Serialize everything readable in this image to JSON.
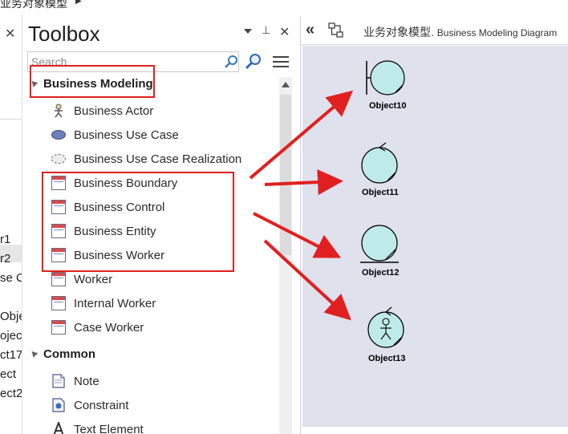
{
  "breadcrumb": {
    "text": "业务对象模型"
  },
  "left_panel": {
    "fragments": [
      "r1",
      "r2",
      "se C",
      "Obje",
      "oject",
      "ct17",
      "ect",
      "ect2"
    ]
  },
  "toolbox": {
    "title": "Toolbox",
    "search_placeholder": "Search",
    "groups": [
      {
        "label": "Business Modeling",
        "items": [
          {
            "label": "Business Actor",
            "icon": "actor-icon"
          },
          {
            "label": "Business Use Case",
            "icon": "use-case-icon"
          },
          {
            "label": "Business Use Case Realization",
            "icon": "use-case-realization-icon"
          },
          {
            "label": "Business Boundary",
            "icon": "class-icon"
          },
          {
            "label": "Business Control",
            "icon": "class-icon"
          },
          {
            "label": "Business Entity",
            "icon": "class-icon"
          },
          {
            "label": "Business Worker",
            "icon": "class-icon"
          },
          {
            "label": "Worker",
            "icon": "class-icon"
          },
          {
            "label": "Internal Worker",
            "icon": "class-icon"
          },
          {
            "label": "Case Worker",
            "icon": "class-icon"
          }
        ]
      },
      {
        "label": "Common",
        "items": [
          {
            "label": "Note",
            "icon": "note-icon"
          },
          {
            "label": "Constraint",
            "icon": "constraint-icon"
          },
          {
            "label": "Text Element",
            "icon": "text-element-icon"
          }
        ]
      }
    ]
  },
  "diagram": {
    "title": "业务对象模型.",
    "subtitle": "Business Modeling Diagram",
    "objects": [
      {
        "name": "Object10",
        "kind": "business-boundary"
      },
      {
        "name": "Object11",
        "kind": "business-control"
      },
      {
        "name": "Object12",
        "kind": "business-entity"
      },
      {
        "name": "Object13",
        "kind": "business-worker"
      }
    ]
  },
  "colors": {
    "highlight": "#e02020",
    "canvas": "#dfe1ed",
    "object_fill": "#bfeaea"
  }
}
